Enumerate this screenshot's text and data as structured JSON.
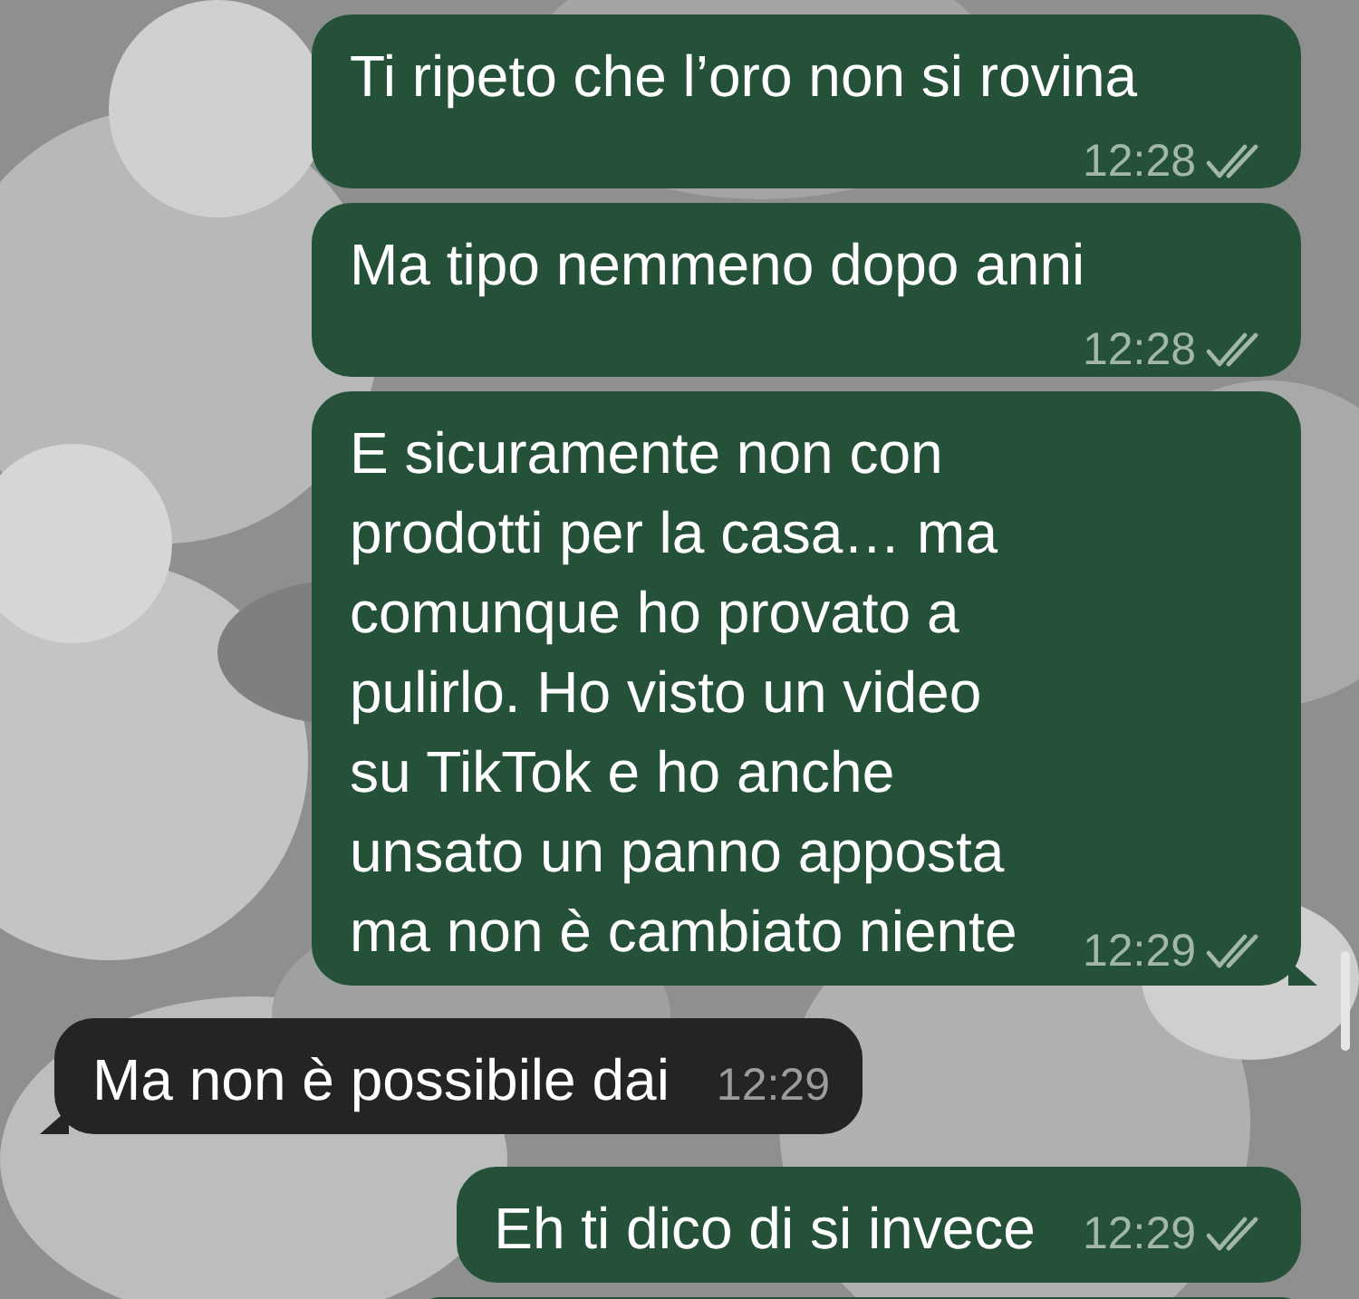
{
  "messages": [
    {
      "kind": "outgoing",
      "text": "Ti ripeto che l’oro non si rovina",
      "time": "12:28",
      "double_check": true,
      "tail": false
    },
    {
      "kind": "outgoing",
      "text": "Ma tipo nemmeno dopo anni",
      "time": "12:28",
      "double_check": true,
      "tail": false
    },
    {
      "kind": "outgoing",
      "text": "E sicuramente non con prodotti per la casa… ma comunque ho provato a pulirlo. Ho visto un video su TikTok e ho anche unsato un panno apposta ma non è cambiato niente",
      "time": "12:29",
      "double_check": true,
      "tail": true
    },
    {
      "kind": "incoming",
      "text": "Ma non è possibile dai",
      "time": "12:29",
      "tail": true
    },
    {
      "kind": "outgoing",
      "text": "Eh ti dico di si invece",
      "time": "12:29",
      "double_check": true,
      "tail": false
    },
    {
      "kind": "outgoing",
      "cut_off": true
    }
  ]
}
